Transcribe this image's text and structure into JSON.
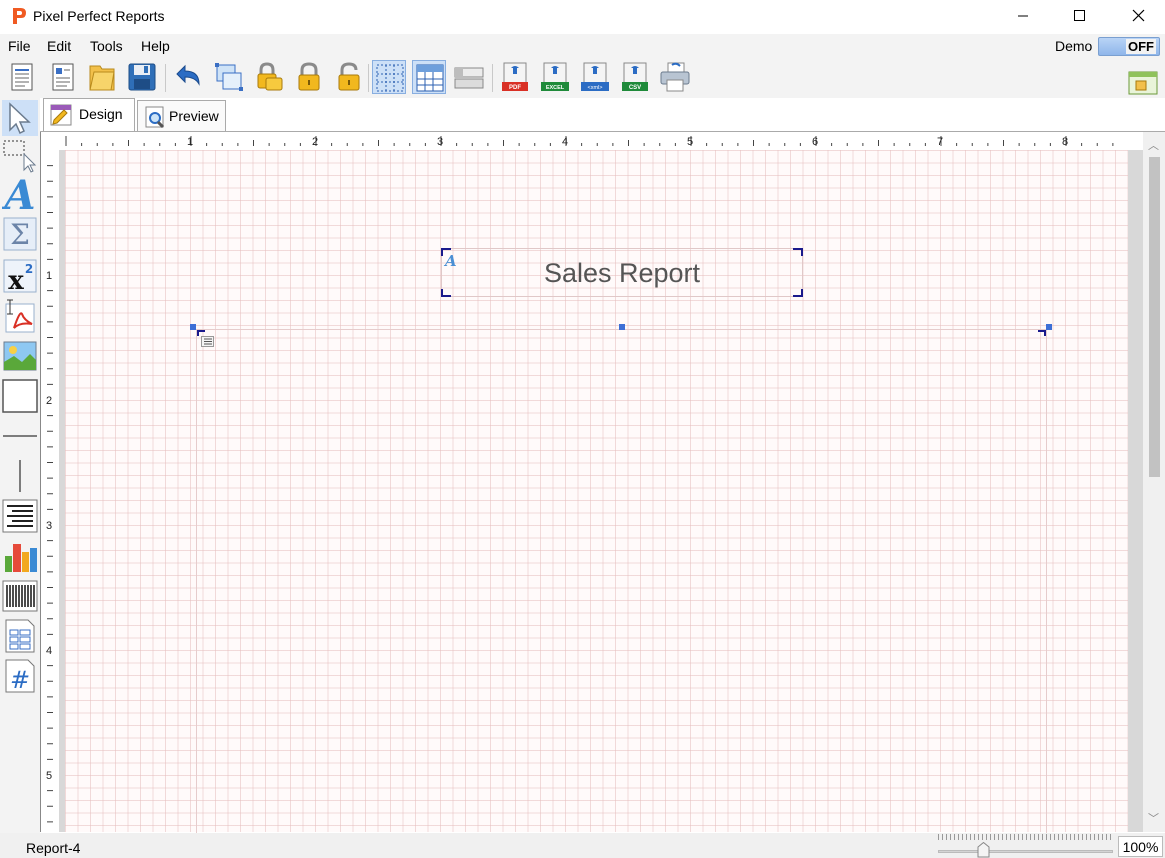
{
  "app": {
    "title": "Pixel Perfect Reports"
  },
  "menu": {
    "items": [
      "File",
      "Edit",
      "Tools",
      "Help"
    ]
  },
  "demo": {
    "label": "Demo",
    "toggle_state": "OFF"
  },
  "toolbar": {
    "icons": [
      "new-report-icon",
      "report-wizard-icon",
      "open-folder-icon",
      "save-icon",
      "undo-icon",
      "group-objects-icon",
      "lock-all-icon",
      "lock-icon",
      "unlock-icon",
      "grid-toggle-icon",
      "snap-to-grid-icon",
      "bands-icon",
      "export-pdf-icon",
      "export-excel-icon",
      "export-xml-icon",
      "export-csv-icon",
      "print-icon",
      "data-source-icon"
    ],
    "badges": {
      "pdf": "PDF",
      "excel": "EXCEL",
      "xml": "<xml>",
      "csv": "CSV"
    }
  },
  "tabs": {
    "design": "Design",
    "preview": "Preview"
  },
  "rulers": {
    "horizontal": [
      "1",
      "2",
      "3",
      "4",
      "5",
      "6",
      "7",
      "8"
    ],
    "vertical": [
      "1",
      "2",
      "3",
      "4",
      "5"
    ]
  },
  "report": {
    "title_text": "Sales Report"
  },
  "status": {
    "report_name": "Report-4",
    "zoom": "100%"
  },
  "colors": {
    "accent": "#3d6fd6",
    "grid": "#e6bebe",
    "title_text": "#555555"
  }
}
